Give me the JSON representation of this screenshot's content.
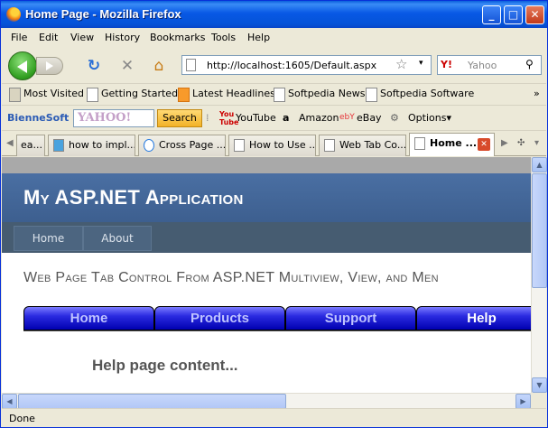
{
  "window": {
    "title": "Home Page - Mozilla Firefox"
  },
  "menu": [
    "File",
    "Edit",
    "View",
    "History",
    "Bookmarks",
    "Tools",
    "Help"
  ],
  "nav": {
    "url": "http://localhost:1605/Default.aspx",
    "search_placeholder": "Yahoo",
    "search_engine_icon": "Y!"
  },
  "bookmarks": [
    "Most Visited",
    "Getting Started",
    "Latest Headlines",
    "Softpedia News",
    "Softpedia Software"
  ],
  "toolbar": {
    "brand": "BienneSoft",
    "yahoo_logo": "YAHOO!",
    "search_label": "Search",
    "youtube": "YouTube",
    "amazon": "Amazon",
    "ebay": "eBay",
    "options": "Options"
  },
  "tabs": [
    {
      "label": "ea..."
    },
    {
      "label": "how to impl..."
    },
    {
      "label": "Cross Page ..."
    },
    {
      "label": "How to Use ..."
    },
    {
      "label": "Web Tab Co..."
    },
    {
      "label": "Home ..."
    }
  ],
  "site": {
    "title": "My ASP.NET Application",
    "nav": [
      "Home",
      "About"
    ],
    "heading": "Web Page Tab Control From ASP.NET Multiview, View, and Men",
    "tabs": [
      "Home",
      "Products",
      "Support",
      "Help"
    ],
    "selected_tab": "Help",
    "content": "Help page content..."
  },
  "status": "Done"
}
